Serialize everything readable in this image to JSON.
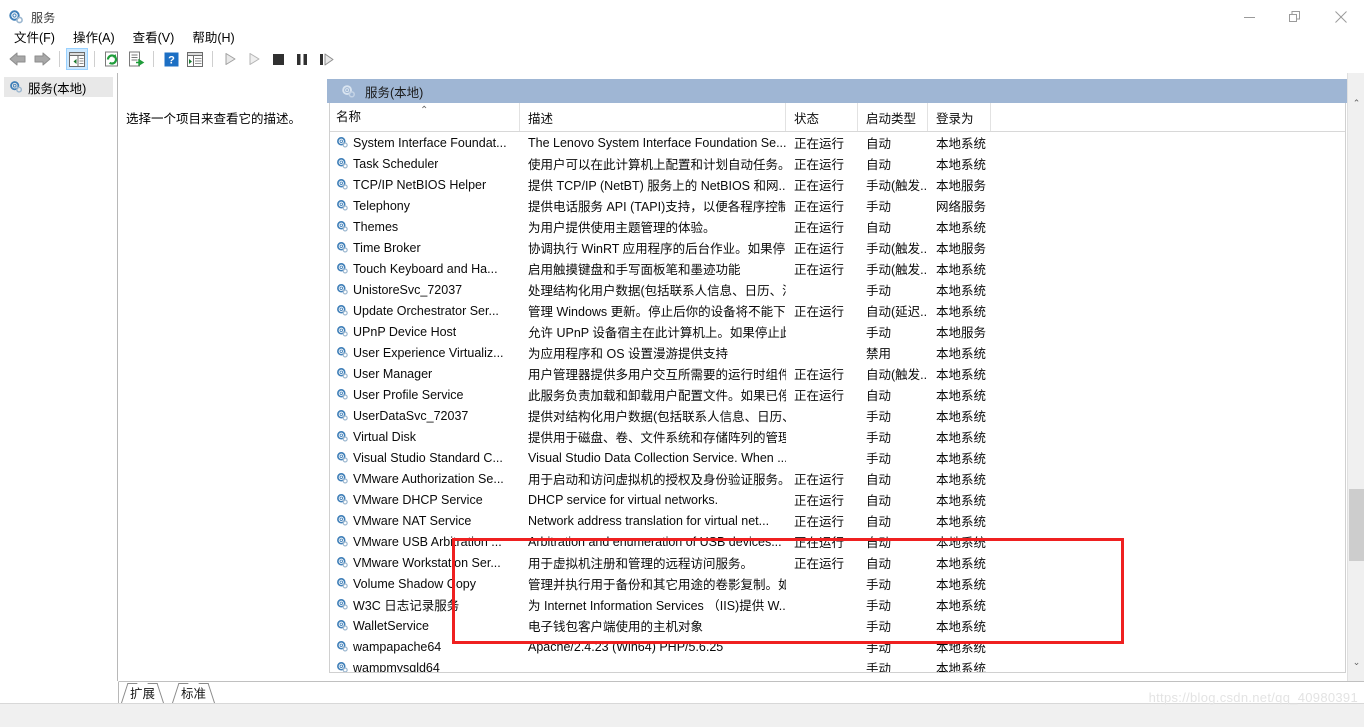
{
  "window": {
    "title": "服务",
    "icon": "services-gear-icon",
    "minimize_label": "最小化",
    "restore_label": "还原",
    "close_label": "关闭"
  },
  "menu": {
    "items": [
      {
        "label": "文件(F)",
        "name": "menu-file"
      },
      {
        "label": "操作(A)",
        "name": "menu-action"
      },
      {
        "label": "查看(V)",
        "name": "menu-view"
      },
      {
        "label": "帮助(H)",
        "name": "menu-help"
      }
    ]
  },
  "toolbar": {
    "buttons": [
      {
        "name": "back-icon",
        "tip": "后退"
      },
      {
        "name": "forward-icon",
        "tip": "前进"
      },
      {
        "name": "show-tree-icon",
        "tip": "显示/隐藏控制台树",
        "selected": true
      },
      {
        "name": "refresh-icon",
        "tip": "刷新"
      },
      {
        "name": "export-list-icon",
        "tip": "导出列表"
      },
      {
        "name": "help-icon",
        "tip": "帮助"
      },
      {
        "name": "properties-icon",
        "tip": "属性"
      },
      {
        "name": "start-service-icon",
        "tip": "启动服务"
      },
      {
        "name": "restart-service-icon",
        "tip": "重启动服务"
      },
      {
        "name": "stop-service-icon",
        "tip": "停止服务"
      },
      {
        "name": "pause-service-icon",
        "tip": "暂停服务"
      },
      {
        "name": "resume-service-icon",
        "tip": "恢复服务"
      }
    ]
  },
  "tree": {
    "node_label": "服务(本地)",
    "node_icon": "services-gear-icon"
  },
  "pane": {
    "header_title": "服务(本地)",
    "header_icon": "services-gear-icon",
    "header_color": "#9fb6d4",
    "description_hint": "选择一个项目来查看它的描述。"
  },
  "list": {
    "sort_column": "名称",
    "sort_direction": "ascending",
    "sort_caret": "⌃",
    "columns": [
      {
        "key": "name",
        "label": "名称"
      },
      {
        "key": "desc",
        "label": "描述"
      },
      {
        "key": "state",
        "label": "状态"
      },
      {
        "key": "start",
        "label": "启动类型"
      },
      {
        "key": "logon",
        "label": "登录为"
      }
    ],
    "rows": [
      {
        "name": "System Interface Foundat...",
        "desc": "The Lenovo System Interface Foundation Se...",
        "state": "正在运行",
        "start": "自动",
        "logon": "本地系统"
      },
      {
        "name": "Task Scheduler",
        "desc": "使用户可以在此计算机上配置和计划自动任务。...",
        "state": "正在运行",
        "start": "自动",
        "logon": "本地系统"
      },
      {
        "name": "TCP/IP NetBIOS Helper",
        "desc": "提供 TCP/IP (NetBT) 服务上的 NetBIOS 和网...",
        "state": "正在运行",
        "start": "手动(触发...",
        "logon": "本地服务"
      },
      {
        "name": "Telephony",
        "desc": "提供电话服务 API (TAPI)支持，以便各程序控制...",
        "state": "正在运行",
        "start": "手动",
        "logon": "网络服务"
      },
      {
        "name": "Themes",
        "desc": "为用户提供使用主题管理的体验。",
        "state": "正在运行",
        "start": "自动",
        "logon": "本地系统"
      },
      {
        "name": "Time Broker",
        "desc": "协调执行 WinRT 应用程序的后台作业。如果停...",
        "state": "正在运行",
        "start": "手动(触发...",
        "logon": "本地服务"
      },
      {
        "name": "Touch Keyboard and Ha...",
        "desc": "启用触摸键盘和手写面板笔和墨迹功能",
        "state": "正在运行",
        "start": "手动(触发...",
        "logon": "本地系统"
      },
      {
        "name": "UnistoreSvc_72037",
        "desc": "处理结构化用户数据(包括联系人信息、日历、消...",
        "state": "",
        "start": "手动",
        "logon": "本地系统"
      },
      {
        "name": "Update Orchestrator Ser...",
        "desc": "管理 Windows 更新。停止后你的设备将不能下...",
        "state": "正在运行",
        "start": "自动(延迟...",
        "logon": "本地系统"
      },
      {
        "name": "UPnP Device Host",
        "desc": "允许 UPnP 设备宿主在此计算机上。如果停止此...",
        "state": "",
        "start": "手动",
        "logon": "本地服务"
      },
      {
        "name": "User Experience Virtualiz...",
        "desc": "为应用程序和 OS 设置漫游提供支持",
        "state": "",
        "start": "禁用",
        "logon": "本地系统"
      },
      {
        "name": "User Manager",
        "desc": "用户管理器提供多用户交互所需要的运行时组件...",
        "state": "正在运行",
        "start": "自动(触发...",
        "logon": "本地系统"
      },
      {
        "name": "User Profile Service",
        "desc": "此服务负责加载和卸载用户配置文件。如果已停...",
        "state": "正在运行",
        "start": "自动",
        "logon": "本地系统"
      },
      {
        "name": "UserDataSvc_72037",
        "desc": "提供对结构化用户数据(包括联系人信息、日历、...",
        "state": "",
        "start": "手动",
        "logon": "本地系统"
      },
      {
        "name": "Virtual Disk",
        "desc": "提供用于磁盘、卷、文件系统和存储阵列的管理...",
        "state": "",
        "start": "手动",
        "logon": "本地系统"
      },
      {
        "name": "Visual Studio Standard C...",
        "desc": "Visual Studio Data Collection Service. When ...",
        "state": "",
        "start": "手动",
        "logon": "本地系统"
      },
      {
        "name": "VMware Authorization Se...",
        "desc": "用于启动和访问虚拟机的授权及身份验证服务。",
        "state": "正在运行",
        "start": "自动",
        "logon": "本地系统",
        "highlighted": true
      },
      {
        "name": "VMware DHCP Service",
        "desc": "DHCP service for virtual networks.",
        "state": "正在运行",
        "start": "自动",
        "logon": "本地系统",
        "highlighted": true
      },
      {
        "name": "VMware NAT Service",
        "desc": "Network address translation for virtual net...",
        "state": "正在运行",
        "start": "自动",
        "logon": "本地系统",
        "highlighted": true
      },
      {
        "name": "VMware USB Arbitration ...",
        "desc": "Arbitration and enumeration of USB devices...",
        "state": "正在运行",
        "start": "自动",
        "logon": "本地系统",
        "highlighted": true
      },
      {
        "name": "VMware Workstation Ser...",
        "desc": "用于虚拟机注册和管理的远程访问服务。",
        "state": "正在运行",
        "start": "自动",
        "logon": "本地系统",
        "highlighted": true
      },
      {
        "name": "Volume Shadow Copy",
        "desc": "管理并执行用于备份和其它用途的卷影复制。如...",
        "state": "",
        "start": "手动",
        "logon": "本地系统"
      },
      {
        "name": "W3C 日志记录服务",
        "desc": "为 Internet Information Services （IIS)提供 W...",
        "state": "",
        "start": "手动",
        "logon": "本地系统"
      },
      {
        "name": "WalletService",
        "desc": "电子钱包客户端使用的主机对象",
        "state": "",
        "start": "手动",
        "logon": "本地系统"
      },
      {
        "name": "wampapache64",
        "desc": "Apache/2.4.23 (Win64) PHP/5.6.25",
        "state": "",
        "start": "手动",
        "logon": "本地系统"
      },
      {
        "name": "wampmysqld64",
        "desc": "",
        "state": "",
        "start": "手动",
        "logon": "本地系统"
      }
    ],
    "annotation": {
      "type": "red-rectangle",
      "color": "#ef2020",
      "covers_rows": [
        "VMware Authorization Se...",
        "VMware DHCP Service",
        "VMware NAT Service",
        "VMware USB Arbitration ...",
        "VMware Workstation Ser..."
      ]
    }
  },
  "scrollbar": {
    "up_arrow": "⌃",
    "down_arrow": "⌄",
    "thumb_position_percent": 76
  },
  "tabs": [
    {
      "label": "扩展",
      "name": "tab-extended",
      "active": false
    },
    {
      "label": "标准",
      "name": "tab-standard",
      "active": true
    }
  ],
  "watermark": "https://blog.csdn.net/qq_40980391"
}
